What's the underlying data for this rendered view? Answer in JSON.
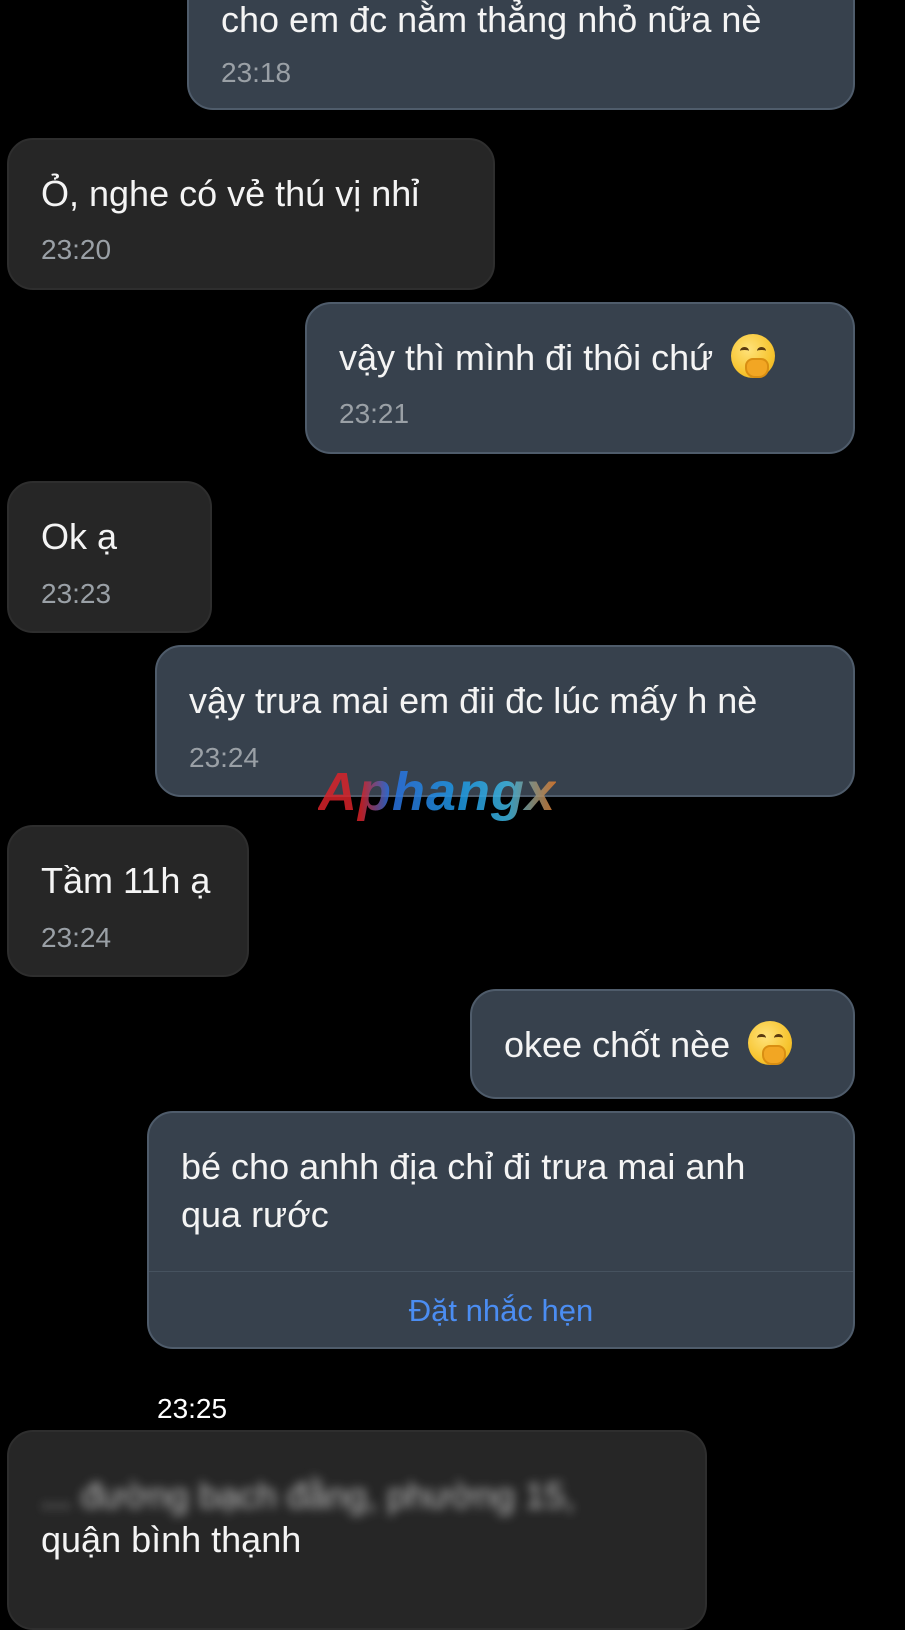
{
  "conversation": {
    "messages": [
      {
        "id": "m1",
        "side": "sent",
        "text": "cho em đc nằm thẳng nhỏ nữa nè",
        "time": "23:18"
      },
      {
        "id": "m2",
        "side": "received",
        "text": "Ỏ, nghe có vẻ thú vị nhỉ",
        "time": "23:20"
      },
      {
        "id": "m3",
        "side": "sent",
        "text": "vậy thì mình đi thôi chứ",
        "emoji": "hand-over-mouth",
        "time": "23:21"
      },
      {
        "id": "m4",
        "side": "received",
        "text": "Ok ạ",
        "time": "23:23"
      },
      {
        "id": "m5",
        "side": "sent",
        "text": "vậy trưa mai em đii đc lúc mấy h nè",
        "time": "23:24"
      },
      {
        "id": "m6",
        "side": "received",
        "text": "Tầm 11h ạ",
        "time": "23:24"
      },
      {
        "id": "m7",
        "side": "sent",
        "text": "okee chốt nèe",
        "emoji": "hand-over-mouth"
      },
      {
        "id": "m8",
        "side": "sent",
        "line1": "bé cho anhh địa chỉ đi trưa mai anh",
        "line2": "qua rước",
        "action": "Đặt nhắc hẹn",
        "time": "23:25"
      },
      {
        "id": "m9",
        "side": "received",
        "line1": "... đường bạch đằng, phường 15,",
        "line2": "quận bình thạnh"
      }
    ]
  },
  "watermark": {
    "text": "Aphangx"
  },
  "colors": {
    "background": "#000000",
    "sent_bubble": "#37414d",
    "received_bubble": "#262626",
    "timestamp": "#9aa0a6",
    "action_link": "#4b8df2"
  }
}
